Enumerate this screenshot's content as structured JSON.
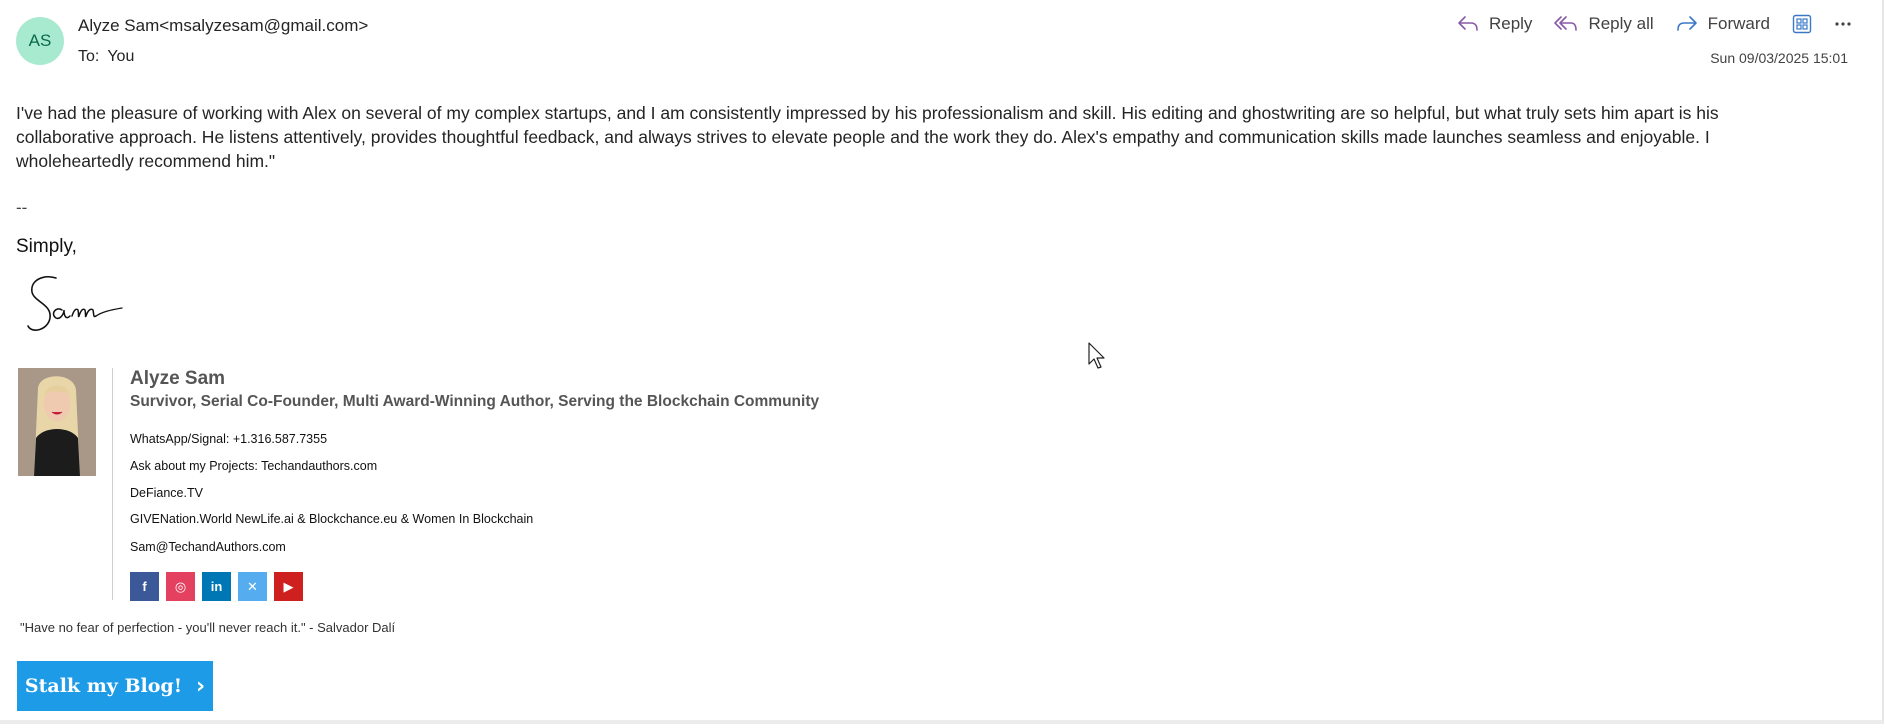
{
  "header": {
    "avatar_initials": "AS",
    "sender": "Alyze Sam<msalyzesam@gmail.com>",
    "to_label": "To:",
    "to_value": "You",
    "date": "Sun 09/03/2025 15:01",
    "actions": {
      "reply": "Reply",
      "reply_all": "Reply all",
      "forward": "Forward"
    }
  },
  "body": {
    "paragraph": "I've had the pleasure of working with Alex on several of my complex startups, and I am consistently impressed by his professionalism and skill. His editing and ghostwriting are so helpful, but what truly sets him apart is his collaborative approach. He listens attentively, provides thoughtful feedback, and always strives to elevate people and the work they do. Alex's empathy and communication skills made launches seamless and enjoyable. I wholeheartedly recommend him.\"",
    "dashes": "--",
    "closing": "Simply,",
    "signature_script": "Sam"
  },
  "signature": {
    "name": "Alyze Sam",
    "title": "Survivor, Serial Co-Founder, Multi Award-Winning Author, Serving the Blockchain Community",
    "lines": [
      "WhatsApp/Signal: +1.316.587.7355",
      "Ask about my Projects: Techandauthors.com",
      "DeFiance.TV",
      "GIVENation.World NewLife.ai & Blockchance.eu & Women In Blockchain",
      "Sam@TechandAuthors.com"
    ],
    "socials": [
      {
        "name": "facebook",
        "glyph": "f",
        "color": "#3b5998"
      },
      {
        "name": "instagram",
        "glyph": "◎",
        "color": "#e4405f"
      },
      {
        "name": "linkedin",
        "glyph": "in",
        "color": "#0077b5"
      },
      {
        "name": "x",
        "glyph": "✕",
        "color": "#55acee"
      },
      {
        "name": "youtube",
        "glyph": "▶",
        "color": "#cd201f"
      }
    ],
    "quote": "\"Have no fear of perfection - you'll never reach it.\" - Salvador Dalí",
    "blog_button": "Stalk my Blog!"
  },
  "colors": {
    "avatar_bg": "#a8ead0",
    "action_icon": "#8a5aa8",
    "forward_icon": "#3a78c8",
    "blog_button": "#1e9be6"
  }
}
